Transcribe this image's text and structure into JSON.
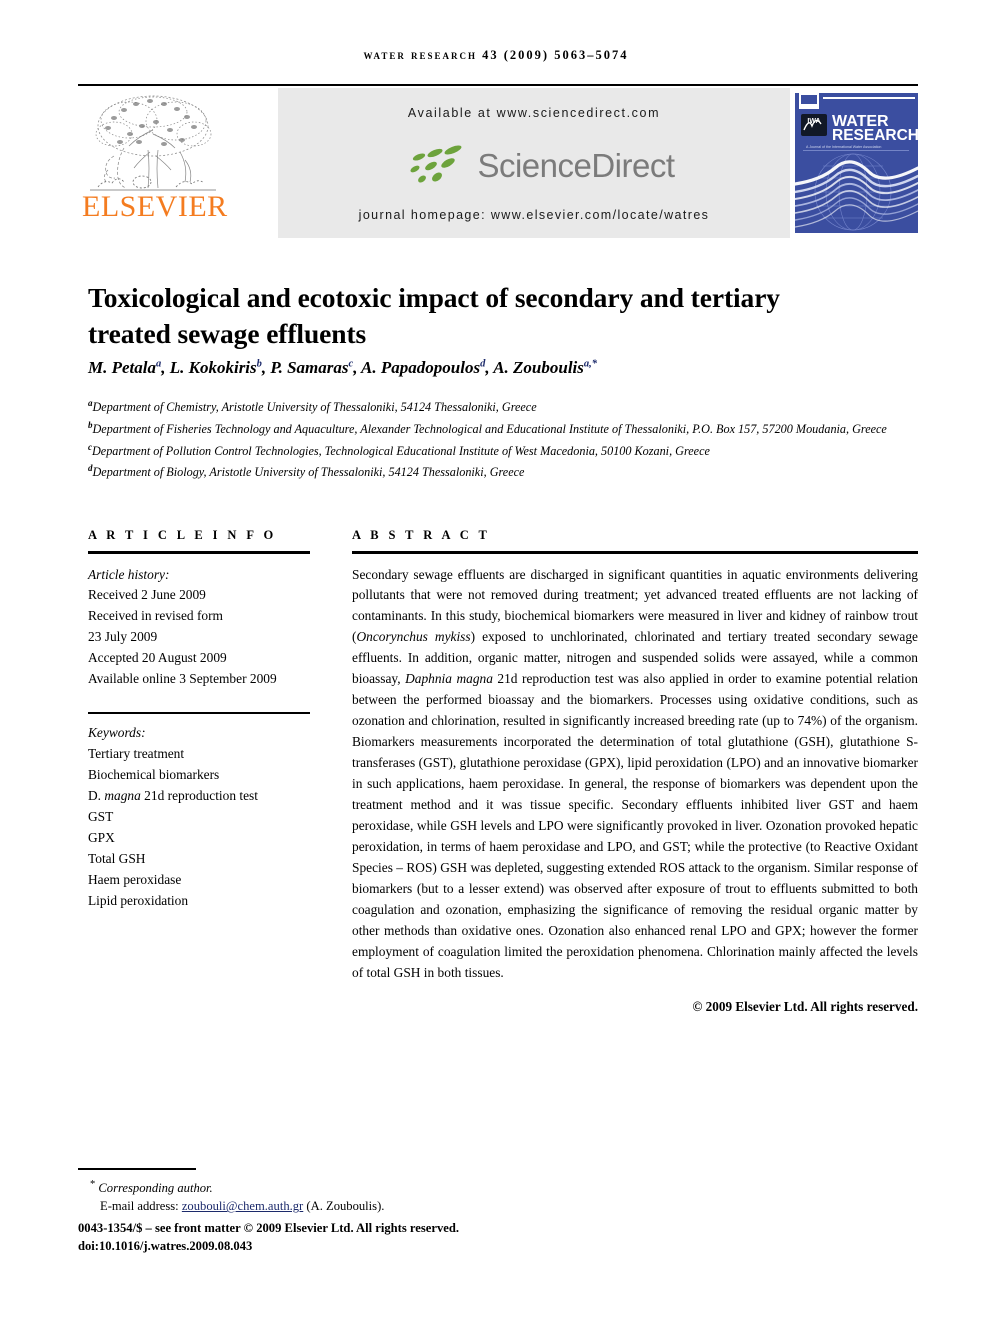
{
  "running_head": "Water Research 43 (2009) 5063–5074",
  "masthead": {
    "publisher_name": "ELSEVIER",
    "available_at": "Available at www.sciencedirect.com",
    "sciencedirect_wordmark": "ScienceDirect",
    "journal_homepage": "journal homepage: www.elsevier.com/locate/watres",
    "cover": {
      "association_badge": "IWA",
      "journal_title_line1": "WATER",
      "journal_title_line2": "RESEARCH",
      "journal_subtitle": "A Journal of the International Water Association"
    }
  },
  "article": {
    "title": "Toxicological and ecotoxic impact of secondary and tertiary treated sewage effluents",
    "authors_html": "M. Petala<sup>a</sup>, L. Kokokiris<sup>b</sup>, P. Samaras<sup>c</sup>, A. Papadopoulos<sup>d</sup>, A. Zouboulis<sup>a,*</sup>",
    "affiliations": [
      {
        "marker": "a",
        "text": "Department of Chemistry, Aristotle University of Thessaloniki, 54124 Thessaloniki, Greece"
      },
      {
        "marker": "b",
        "text": "Department of Fisheries Technology and Aquaculture, Alexander Technological and Educational Institute of Thessaloniki, P.O. Box 157, 57200 Moudania, Greece"
      },
      {
        "marker": "c",
        "text": "Department of Pollution Control Technologies, Technological Educational Institute of West Macedonia, 50100 Kozani, Greece"
      },
      {
        "marker": "d",
        "text": "Department of Biology, Aristotle University of Thessaloniki, 54124 Thessaloniki, Greece"
      }
    ]
  },
  "article_info": {
    "heading": "A R T I C L E  I N F O",
    "history_label": "Article history:",
    "history": [
      "Received 2 June 2009",
      "Received in revised form",
      "23 July 2009",
      "Accepted 20 August 2009",
      "Available online 3 September 2009"
    ],
    "keywords_label": "Keywords:",
    "keywords": [
      "Tertiary treatment",
      "Biochemical biomarkers",
      "D. magna 21d reproduction test",
      "GST",
      "GPX",
      "Total GSH",
      "Haem peroxidase",
      "Lipid peroxidation"
    ]
  },
  "abstract": {
    "heading": "A B S T R A C T",
    "text_html": "Secondary sewage effluents are discharged in significant quantities in aquatic environments delivering pollutants that were not removed during treatment; yet advanced treated effluents are not lacking of contaminants. In this study, biochemical biomarkers were measured in liver and kidney of rainbow trout (<em>Oncorynchus mykiss</em>) exposed to unchlorinated, chlorinated and tertiary treated secondary sewage effluents. In addition, organic matter, nitrogen and suspended solids were assayed, while a common bioassay, <em>Daphnia magna</em> 21d reproduction test was also applied in order to examine potential relation between the performed bioassay and the biomarkers. Processes using oxidative conditions, such as ozonation and chlorination, resulted in significantly increased breeding rate (up to 74%) of the organism. Biomarkers measurements incorporated the determination of total glutathione (GSH), glutathione S-transferases (GST), glutathione peroxidase (GPX), lipid peroxidation (LPO) and an innovative biomarker in such applications, haem peroxidase. In general, the response of biomarkers was dependent upon the treatment method and it was tissue specific. Secondary effluents inhibited liver GST and haem peroxidase, while GSH levels and LPO were significantly provoked in liver. Ozonation provoked hepatic peroxidation, in terms of haem peroxidase and LPO, and GST; while the protective (to Reactive Oxidant Species – ROS) GSH was depleted, suggesting extended ROS attack to the organism. Similar response of biomarkers (but to a lesser extend) was observed after exposure of trout to effluents submitted to both coagulation and ozonation, emphasizing the significance of removing the residual organic matter by other methods than oxidative ones. Ozonation also enhanced renal LPO and GPX; however the former employment of coagulation limited the peroxidation phenomena. Chlorination mainly affected the levels of total GSH in both tissues.",
    "copyright": "© 2009 Elsevier Ltd. All rights reserved."
  },
  "footer": {
    "corresponding_author": "Corresponding author.",
    "email_label": "E-mail address:",
    "email": "zoubouli@chem.auth.gr",
    "email_owner": "(A. Zouboulis).",
    "issn_line": "0043-1354/$ – see front matter © 2009 Elsevier Ltd. All rights reserved.",
    "doi_line": "doi:10.1016/j.watres.2009.08.043"
  },
  "colors": {
    "elsevier_orange": "#F47C20",
    "sciencedirect_green": "#6DA33C",
    "sciencedirect_gray": "#7B7B7B",
    "journal_cover_blue": "#3B4EA0",
    "link_blue": "#1c2a6b",
    "banner_gray": "#E9E9E9"
  }
}
